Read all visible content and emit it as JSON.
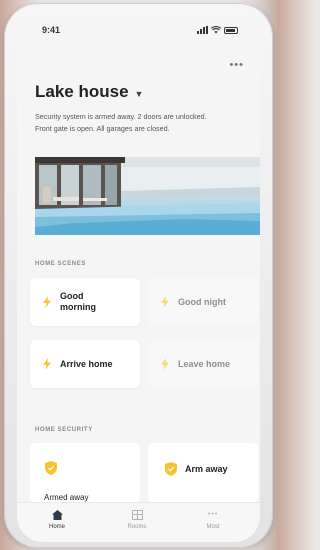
{
  "status_bar": {
    "time": "9:41"
  },
  "header": {
    "title": "Lake house",
    "menu_icon": "ellipsis-icon",
    "summary_line1": "Security system is armed away. 2 doors are unlocked.",
    "summary_line2": "Front gate is open. All garages are closed."
  },
  "scenes": {
    "section_label": "HOME SCENES",
    "items": [
      {
        "label": "Good morning",
        "icon": "bolt-icon",
        "active": true
      },
      {
        "label": "Good night",
        "icon": "bolt-icon",
        "active": false
      },
      {
        "label": "Arrive home",
        "icon": "bolt-icon",
        "active": true
      },
      {
        "label": "Leave home",
        "icon": "bolt-icon",
        "active": false
      }
    ]
  },
  "security": {
    "section_label": "HOME SECURITY",
    "items": [
      {
        "label": "Armed away",
        "icon": "shield-icon"
      },
      {
        "label": "Arm away",
        "icon": "shield-icon"
      }
    ]
  },
  "tabbar": {
    "items": [
      {
        "label": "Home",
        "icon": "home-icon",
        "active": true
      },
      {
        "label": "Rooms",
        "icon": "rooms-icon",
        "active": false
      },
      {
        "label": "Most",
        "icon": "more-icon",
        "active": false
      }
    ]
  },
  "colors": {
    "accent": "#f7c42f",
    "text": "#222222",
    "muted": "#8f8f96"
  }
}
